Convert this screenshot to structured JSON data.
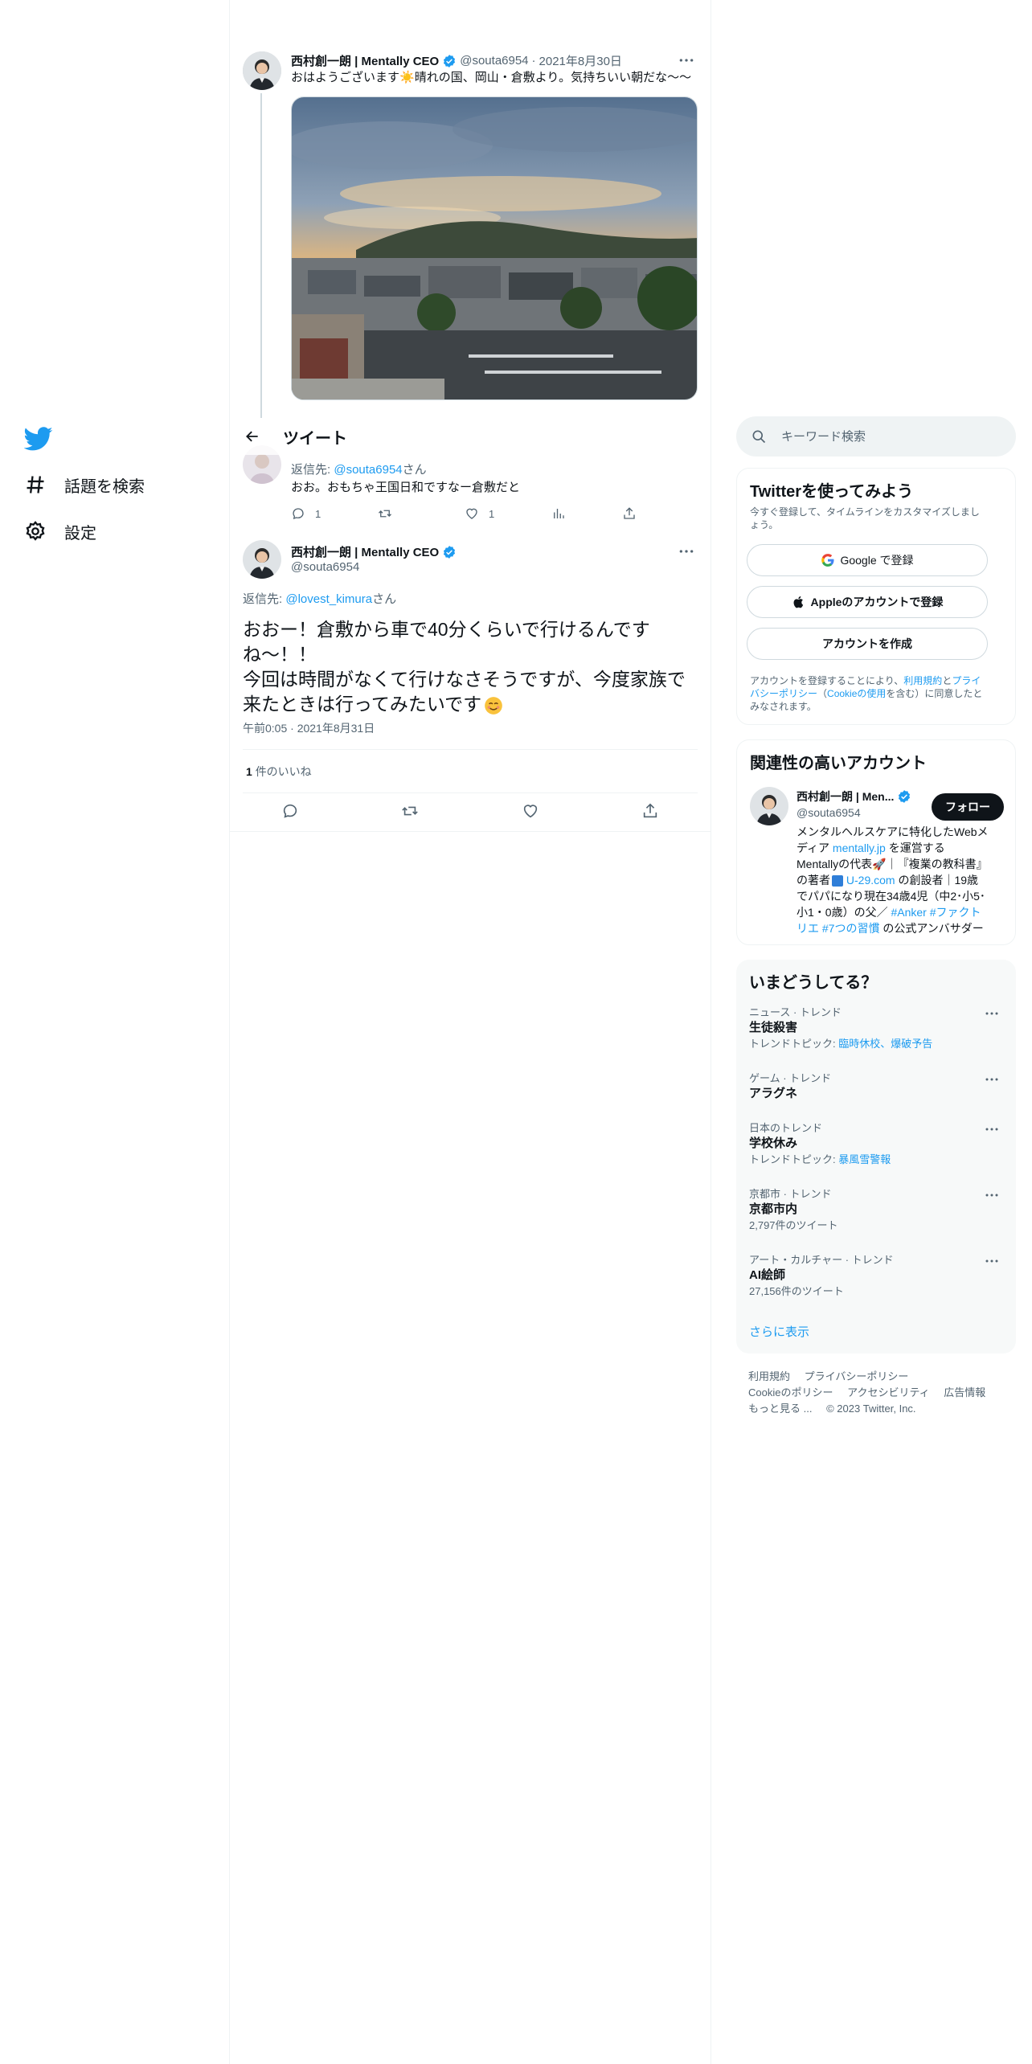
{
  "nav": {
    "items": [
      {
        "label": "話題を検索",
        "icon": "hashtag-icon"
      },
      {
        "label": "設定",
        "icon": "gear-icon"
      }
    ]
  },
  "header": {
    "title": "ツイート"
  },
  "tweet1": {
    "name": "西村創一朗 | Mentally CEO",
    "handle": "@souta6954",
    "dot": "·",
    "date": "2021年8月30日",
    "text_before": "おはようございます",
    "text_after": "晴れの国、岡山・倉敷より。気持ちいい朝だな〜〜"
  },
  "tweet2": {
    "reply_prefix": "返信先:",
    "reply_handle": "@souta6954",
    "reply_suffix": "さん",
    "text": "おお。おもちゃ王国日和ですなー倉敷だと",
    "reply_count": "1",
    "like_count": "1"
  },
  "main_tweet": {
    "name": "西村創一朗 | Mentally CEO",
    "handle": "@souta6954",
    "reply_prefix": "返信先:",
    "reply_handle": "@lovest_kimura",
    "reply_suffix": "さん",
    "line1": "おおー！倉敷から車で40分くらいで行けるんです",
    "line2": "ね〜！！",
    "line3": "今回は時間がなくて行けなさそうですが、今度家族で",
    "line4": "来たときは行ってみたいです",
    "time": "午前0:05",
    "dot": "·",
    "date": "2021年8月31日",
    "likes_count": "1",
    "likes_label": "件のいいね"
  },
  "search": {
    "placeholder": "キーワード検索"
  },
  "signup": {
    "title": "Twitterを使ってみよう",
    "subtitle_line1": "今すぐ登録して、タイムラインをカスタマイズしまし",
    "subtitle_line2": "ょう。",
    "google_button": "Google で登録",
    "apple_button": "Appleのアカウントで登録",
    "create_button": "アカウントを作成",
    "terms_line1_a": "アカウントを登録することにより、",
    "terms_link1": "利用規約",
    "terms_and": "と",
    "terms_link2a": "プライ",
    "terms_link2b": "バシーポリシー",
    "terms_paren_open": "（",
    "terms_link3": "Cookieの使用",
    "terms_line2_end": "を含む）に同意したと",
    "terms_line3": "みなされます。"
  },
  "relevant": {
    "title": "関連性の高いアカウント",
    "name": "西村創一朗 | Men...",
    "handle": "@souta6954",
    "follow_button": "フォロー",
    "bio_line1": "メンタルヘルスケアに特化したWebメ",
    "bio_line2_a": "ディア ",
    "bio_line2_link": "mentally.jp",
    "bio_line2_b": " を運営する",
    "bio_line3": "Mentallyの代表",
    "bio_line3_b": "｜『複業の教科書』",
    "bio_line4_a": "の著者",
    "bio_line4_link": " U-29.com",
    "bio_line4_b": " の創設者｜19歳",
    "bio_line5": "でパパになり現在34歳4児（中2･小5･",
    "bio_line6_a": "小1・0歳）の父／ ",
    "bio_line6_link": "#Anker #ファクト",
    "bio_line7_link": "リエ #7つの習慣",
    "bio_line7_b": " の公式アンバサダー"
  },
  "trends": {
    "title": "いまどうしてる？",
    "items": [
      {
        "context": "ニュース · トレンド",
        "name": "生徒殺害",
        "sub_prefix": "トレンドトピック: ",
        "sub_link": "臨時休校、爆破予告",
        "sub": ""
      },
      {
        "context": "ゲーム · トレンド",
        "name": "アラグネ",
        "sub_prefix": "",
        "sub_link": "",
        "sub": ""
      },
      {
        "context": "日本のトレンド",
        "name": "学校休み",
        "sub_prefix": "トレンドトピック: ",
        "sub_link": "暴風雪警報",
        "sub": ""
      },
      {
        "context": "京都市 · トレンド",
        "name": "京都市内",
        "sub_prefix": "",
        "sub_link": "",
        "sub": "2,797件のツイート"
      },
      {
        "context": "アート・カルチャー · トレンド",
        "name": "AI絵師",
        "sub_prefix": "",
        "sub_link": "",
        "sub": "27,156件のツイート"
      }
    ],
    "show_more": "さらに表示"
  },
  "footer": {
    "row1": [
      "利用規約",
      "プライバシーポリシー"
    ],
    "row2": [
      "Cookieのポリシー",
      "アクセシビリティ",
      "広告情報"
    ],
    "row3": [
      "もっと見る ...",
      "© 2023 Twitter, Inc."
    ]
  },
  "colors": {
    "accent": "#1d9bf0",
    "text": "#0f1419",
    "secondary": "#536471",
    "border": "#eff3f4"
  }
}
